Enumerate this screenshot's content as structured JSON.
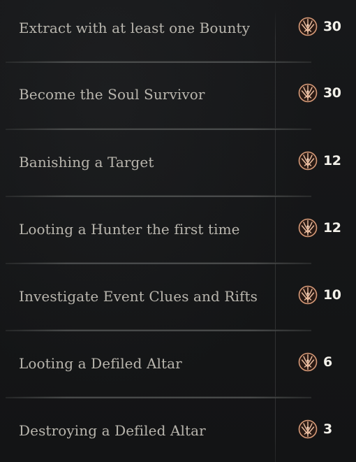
{
  "rows": [
    {
      "label": "Extract with at least one Bounty",
      "value": "30"
    },
    {
      "label": "Become the Soul Survivor",
      "value": "30"
    },
    {
      "label": "Banishing a Target",
      "value": "12"
    },
    {
      "label": "Looting a Hunter the first time",
      "value": "12"
    },
    {
      "label": "Investigate Event Clues and Rifts",
      "value": "10"
    },
    {
      "label": "Looting a Defiled Altar",
      "value": "6"
    },
    {
      "label": "Destroying a Defiled Altar",
      "value": "3"
    }
  ],
  "reward_icon": "hunt-dollar-emblem-icon",
  "colors": {
    "background": "#141516",
    "label_text": "#b9b6ae",
    "value_text": "#f3f1ea",
    "icon_glow": "#c98a6a"
  }
}
